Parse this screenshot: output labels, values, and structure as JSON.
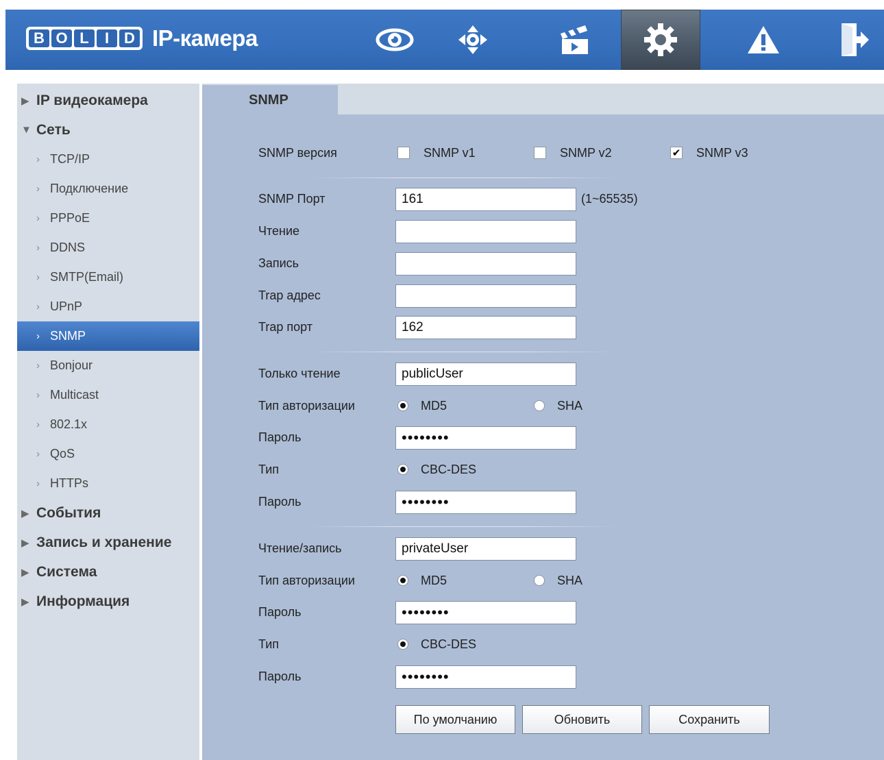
{
  "header": {
    "logo_text": "BOLID",
    "title": "IP-камера",
    "nav": [
      "eye-icon",
      "ptz-icon",
      "clapper-icon",
      "gear-icon",
      "warning-icon",
      "logout-icon"
    ],
    "colors": {
      "header_bg": "#3670bd",
      "active_bg": "#4e5b69"
    }
  },
  "sidebar": {
    "groups": {
      "ip_camera": "IP видеокамера",
      "network": "Сеть",
      "events": "События",
      "record_storage": "Запись и хранение",
      "system": "Система",
      "info": "Информация"
    },
    "network_items": [
      "TCP/IP",
      "Подключение",
      "PPPoE",
      "DDNS",
      "SMTP(Email)",
      "UPnP",
      "SNMP",
      "Bonjour",
      "Multicast",
      "802.1x",
      "QoS",
      "HTTPs"
    ],
    "selected": "SNMP"
  },
  "tab": {
    "label": "SNMP"
  },
  "form": {
    "version_label": "SNMP версия",
    "v1": {
      "label": "SNMP v1",
      "checked": false
    },
    "v2": {
      "label": "SNMP v2",
      "checked": false
    },
    "v3": {
      "label": "SNMP v3",
      "checked": true
    },
    "port_label": "SNMP Порт",
    "port_value": "161",
    "port_hint": "(1~65535)",
    "read_label": "Чтение",
    "read_value": "",
    "write_label": "Запись",
    "write_value": "",
    "trap_addr_label": "Trap адрес",
    "trap_addr_value": "",
    "trap_port_label": "Trap порт",
    "trap_port_value": "162",
    "ro": {
      "label": "Только чтение",
      "user": "publicUser",
      "auth_label": "Тип авторизации",
      "md5": "MD5",
      "sha": "SHA",
      "auth_selected": "MD5",
      "pass_label": "Пароль",
      "pass_value": "••••••••",
      "type_label": "Тип",
      "type_value": "CBC-DES",
      "pass2_label": "Пароль",
      "pass2_value": "••••••••"
    },
    "rw": {
      "label": "Чтение/запись",
      "user": "privateUser",
      "auth_label": "Тип авторизации",
      "md5": "MD5",
      "sha": "SHA",
      "auth_selected": "MD5",
      "pass_label": "Пароль",
      "pass_value": "••••••••",
      "type_label": "Тип",
      "type_value": "CBC-DES",
      "pass2_label": "Пароль",
      "pass2_value": "••••••••"
    }
  },
  "buttons": {
    "default": "По умолчанию",
    "refresh": "Обновить",
    "save": "Сохранить"
  }
}
